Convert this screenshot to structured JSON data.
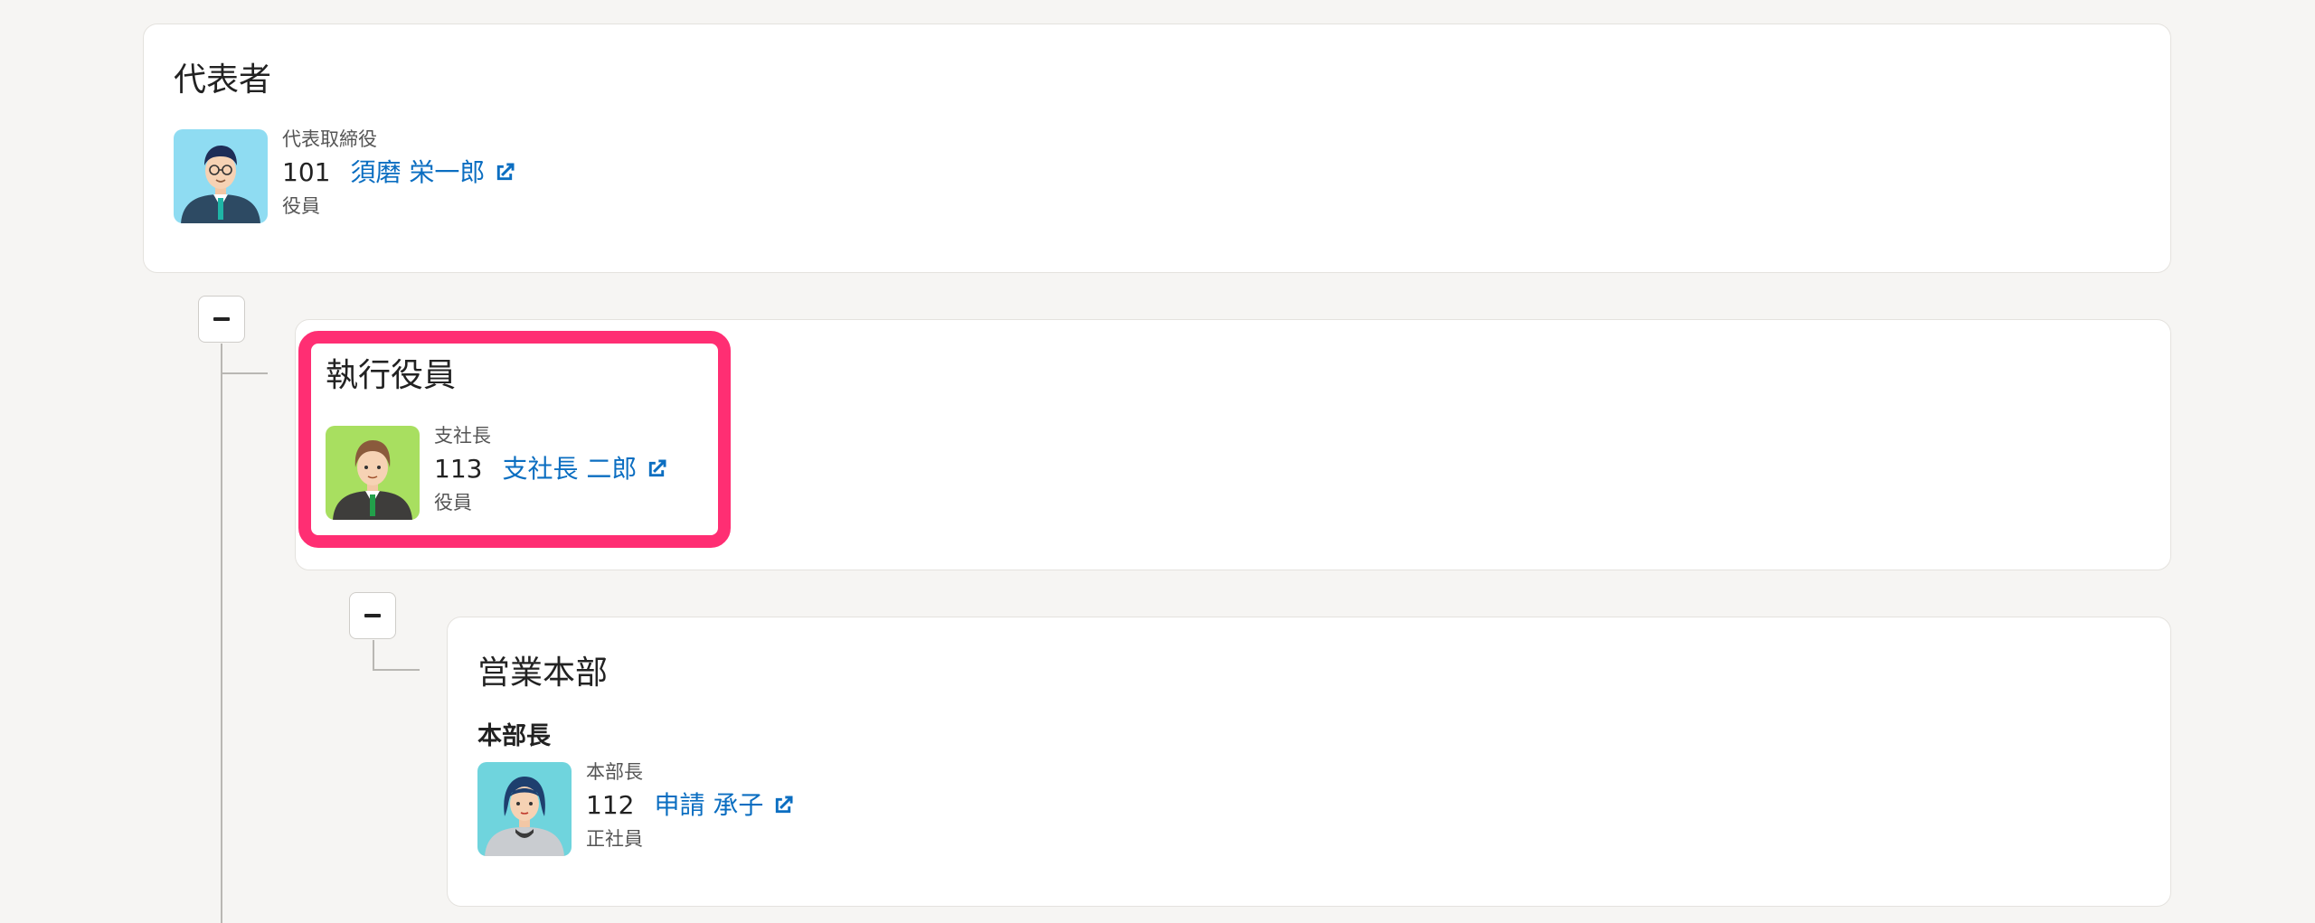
{
  "colors": {
    "link": "#0b6ec1",
    "highlight": "#ff2e73",
    "background": "#f6f5f3"
  },
  "org": {
    "representative": {
      "title": "代表者",
      "member": {
        "position": "代表取締役",
        "id": "101",
        "name": "須磨 栄一郎",
        "type": "役員",
        "icon": "external-link-icon"
      }
    },
    "executive": {
      "title": "執行役員",
      "toggle": "−",
      "member": {
        "position": "支社長",
        "id": "113",
        "name": "支社長 二郎",
        "type": "役員",
        "icon": "external-link-icon"
      }
    },
    "sales": {
      "title": "営業本部",
      "toggle": "−",
      "section_label": "本部長",
      "member": {
        "position": "本部長",
        "id": "112",
        "name": "申請 承子",
        "type": "正社員",
        "icon": "external-link-icon"
      }
    }
  }
}
